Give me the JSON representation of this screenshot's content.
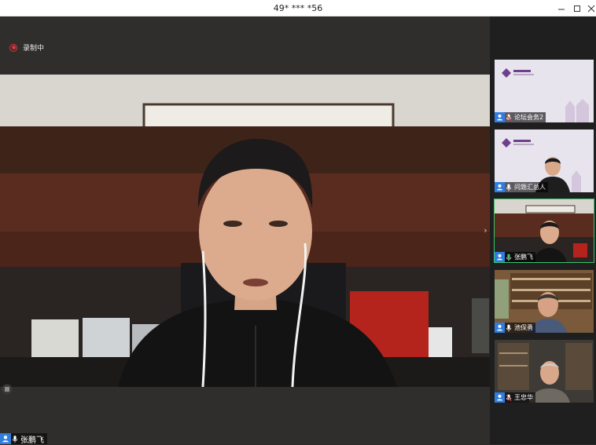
{
  "window": {
    "title": "49* *** *56"
  },
  "recording": {
    "label": "录制中"
  },
  "main_speaker": {
    "name": "张鹏飞"
  },
  "participants": [
    {
      "name": "论坛会务2",
      "mic": "muted",
      "video": "slide",
      "active": false
    },
    {
      "name": "问题汇总人",
      "mic": "on",
      "video": "slide-with-person",
      "active": false
    },
    {
      "name": "张鹏飞",
      "mic": "speaking",
      "video": "camera",
      "active": true
    },
    {
      "name": "池保勇",
      "mic": "on",
      "video": "camera",
      "active": false
    },
    {
      "name": "王忠华",
      "mic": "muted",
      "video": "camera",
      "active": false
    }
  ],
  "colors": {
    "accent_blue": "#2f7de1",
    "active_green": "#3cc46a",
    "recording_red": "#e2343a"
  }
}
